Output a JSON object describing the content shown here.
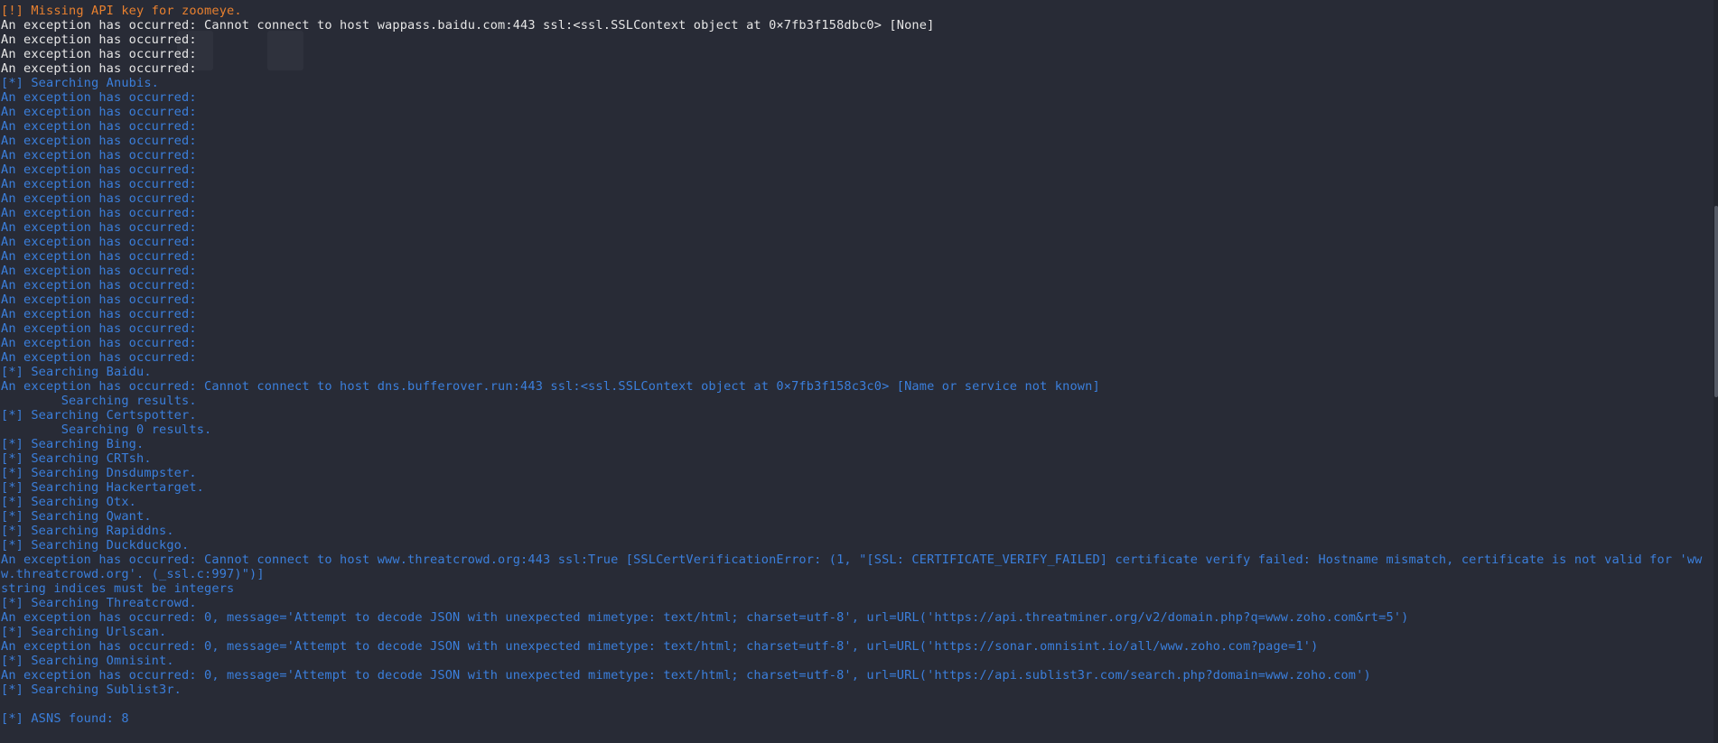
{
  "terminal": {
    "colors": {
      "background": "#282b36",
      "warning": "#e8802f",
      "default_text": "#e6e6e6",
      "info": "#3b7fdc"
    },
    "lines": [
      {
        "text": "[!] Missing API key for zoomeye.",
        "color": "orange"
      },
      {
        "text": "An exception has occurred: Cannot connect to host wappass.baidu.com:443 ssl:<ssl.SSLContext object at 0×7fb3f158dbc0> [None]",
        "color": "white"
      },
      {
        "text": "An exception has occurred:",
        "color": "white"
      },
      {
        "text": "An exception has occurred:",
        "color": "white"
      },
      {
        "text": "An exception has occurred:",
        "color": "white"
      },
      {
        "text": "[*] Searching Anubis.",
        "color": "blue"
      },
      {
        "text": "An exception has occurred:",
        "color": "blue"
      },
      {
        "text": "An exception has occurred:",
        "color": "blue"
      },
      {
        "text": "An exception has occurred:",
        "color": "blue"
      },
      {
        "text": "An exception has occurred:",
        "color": "blue"
      },
      {
        "text": "An exception has occurred:",
        "color": "blue"
      },
      {
        "text": "An exception has occurred:",
        "color": "blue"
      },
      {
        "text": "An exception has occurred:",
        "color": "blue"
      },
      {
        "text": "An exception has occurred:",
        "color": "blue"
      },
      {
        "text": "An exception has occurred:",
        "color": "blue"
      },
      {
        "text": "An exception has occurred:",
        "color": "blue"
      },
      {
        "text": "An exception has occurred:",
        "color": "blue"
      },
      {
        "text": "An exception has occurred:",
        "color": "blue"
      },
      {
        "text": "An exception has occurred:",
        "color": "blue"
      },
      {
        "text": "An exception has occurred:",
        "color": "blue"
      },
      {
        "text": "An exception has occurred:",
        "color": "blue"
      },
      {
        "text": "An exception has occurred:",
        "color": "blue"
      },
      {
        "text": "An exception has occurred:",
        "color": "blue"
      },
      {
        "text": "An exception has occurred:",
        "color": "blue"
      },
      {
        "text": "An exception has occurred:",
        "color": "blue"
      },
      {
        "text": "[*] Searching Baidu.",
        "color": "blue"
      },
      {
        "text": "An exception has occurred: Cannot connect to host dns.bufferover.run:443 ssl:<ssl.SSLContext object at 0×7fb3f158c3c0> [Name or service not known]",
        "color": "blue"
      },
      {
        "text": "        Searching results.",
        "color": "blue"
      },
      {
        "text": "[*] Searching Certspotter.",
        "color": "blue"
      },
      {
        "text": "        Searching 0 results.",
        "color": "blue"
      },
      {
        "text": "[*] Searching Bing.",
        "color": "blue"
      },
      {
        "text": "[*] Searching CRTsh.",
        "color": "blue"
      },
      {
        "text": "[*] Searching Dnsdumpster.",
        "color": "blue"
      },
      {
        "text": "[*] Searching Hackertarget.",
        "color": "blue"
      },
      {
        "text": "[*] Searching Otx.",
        "color": "blue"
      },
      {
        "text": "[*] Searching Qwant.",
        "color": "blue"
      },
      {
        "text": "[*] Searching Rapiddns.",
        "color": "blue"
      },
      {
        "text": "[*] Searching Duckduckgo.",
        "color": "blue"
      },
      {
        "text": "An exception has occurred: Cannot connect to host www.threatcrowd.org:443 ssl:True [SSLCertVerificationError: (1, \"[SSL: CERTIFICATE_VERIFY_FAILED] certificate verify failed: Hostname mismatch, certificate is not valid for 'www.threatcrowd.org'. (_ssl.c:997)\")]",
        "color": "blue"
      },
      {
        "text": "string indices must be integers",
        "color": "blue"
      },
      {
        "text": "[*] Searching Threatcrowd.",
        "color": "blue"
      },
      {
        "text": "An exception has occurred: 0, message='Attempt to decode JSON with unexpected mimetype: text/html; charset=utf-8', url=URL('https://api.threatminer.org/v2/domain.php?q=www.zoho.com&rt=5')",
        "color": "blue"
      },
      {
        "text": "[*] Searching Urlscan.",
        "color": "blue"
      },
      {
        "text": "An exception has occurred: 0, message='Attempt to decode JSON with unexpected mimetype: text/html; charset=utf-8', url=URL('https://sonar.omnisint.io/all/www.zoho.com?page=1')",
        "color": "blue"
      },
      {
        "text": "[*] Searching Omnisint.",
        "color": "blue"
      },
      {
        "text": "An exception has occurred: 0, message='Attempt to decode JSON with unexpected mimetype: text/html; charset=utf-8', url=URL('https://api.sublist3r.com/search.php?domain=www.zoho.com')",
        "color": "blue"
      },
      {
        "text": "[*] Searching Sublist3r.",
        "color": "blue"
      },
      {
        "text": "",
        "color": "blue"
      },
      {
        "text": "[*] ASNS found: 8",
        "color": "blue"
      }
    ]
  }
}
